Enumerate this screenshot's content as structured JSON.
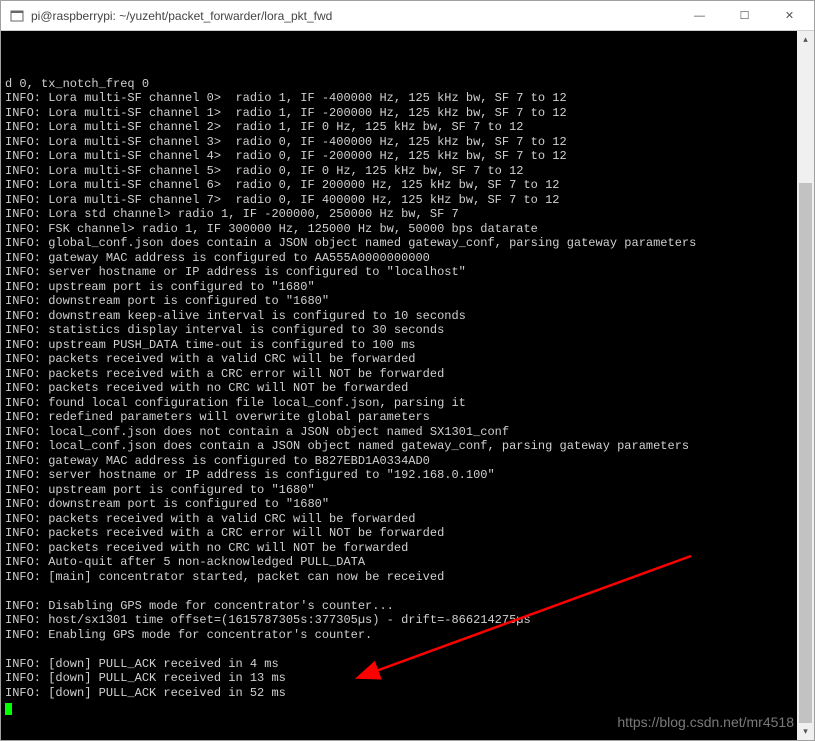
{
  "window": {
    "title": "pi@raspberrypi: ~/yuzeht/packet_forwarder/lora_pkt_fwd",
    "icons": {
      "app": "terminal-icon",
      "minimize": "minimize-icon",
      "maximize": "maximize-icon",
      "close": "close-icon"
    }
  },
  "terminal": {
    "lines": [
      "d 0, tx_notch_freq 0",
      "INFO: Lora multi-SF channel 0>  radio 1, IF -400000 Hz, 125 kHz bw, SF 7 to 12",
      "INFO: Lora multi-SF channel 1>  radio 1, IF -200000 Hz, 125 kHz bw, SF 7 to 12",
      "INFO: Lora multi-SF channel 2>  radio 1, IF 0 Hz, 125 kHz bw, SF 7 to 12",
      "INFO: Lora multi-SF channel 3>  radio 0, IF -400000 Hz, 125 kHz bw, SF 7 to 12",
      "INFO: Lora multi-SF channel 4>  radio 0, IF -200000 Hz, 125 kHz bw, SF 7 to 12",
      "INFO: Lora multi-SF channel 5>  radio 0, IF 0 Hz, 125 kHz bw, SF 7 to 12",
      "INFO: Lora multi-SF channel 6>  radio 0, IF 200000 Hz, 125 kHz bw, SF 7 to 12",
      "INFO: Lora multi-SF channel 7>  radio 0, IF 400000 Hz, 125 kHz bw, SF 7 to 12",
      "INFO: Lora std channel> radio 1, IF -200000, 250000 Hz bw, SF 7",
      "INFO: FSK channel> radio 1, IF 300000 Hz, 125000 Hz bw, 50000 bps datarate",
      "INFO: global_conf.json does contain a JSON object named gateway_conf, parsing gateway parameters",
      "INFO: gateway MAC address is configured to AA555A0000000000",
      "INFO: server hostname or IP address is configured to \"localhost\"",
      "INFO: upstream port is configured to \"1680\"",
      "INFO: downstream port is configured to \"1680\"",
      "INFO: downstream keep-alive interval is configured to 10 seconds",
      "INFO: statistics display interval is configured to 30 seconds",
      "INFO: upstream PUSH_DATA time-out is configured to 100 ms",
      "INFO: packets received with a valid CRC will be forwarded",
      "INFO: packets received with a CRC error will NOT be forwarded",
      "INFO: packets received with no CRC will NOT be forwarded",
      "INFO: found local configuration file local_conf.json, parsing it",
      "INFO: redefined parameters will overwrite global parameters",
      "INFO: local_conf.json does not contain a JSON object named SX1301_conf",
      "INFO: local_conf.json does contain a JSON object named gateway_conf, parsing gateway parameters",
      "INFO: gateway MAC address is configured to B827EBD1A0334AD0",
      "INFO: server hostname or IP address is configured to \"192.168.0.100\"",
      "INFO: upstream port is configured to \"1680\"",
      "INFO: downstream port is configured to \"1680\"",
      "INFO: packets received with a valid CRC will be forwarded",
      "INFO: packets received with a CRC error will NOT be forwarded",
      "INFO: packets received with no CRC will NOT be forwarded",
      "INFO: Auto-quit after 5 non-acknowledged PULL_DATA",
      "INFO: [main] concentrator started, packet can now be received",
      "",
      "INFO: Disabling GPS mode for concentrator's counter...",
      "INFO: host/sx1301 time offset=(1615787305s:377305µs) - drift=-866214275µs",
      "INFO: Enabling GPS mode for concentrator's counter.",
      "",
      "INFO: [down] PULL_ACK received in 4 ms",
      "INFO: [down] PULL_ACK received in 13 ms",
      "INFO: [down] PULL_ACK received in 52 ms"
    ]
  },
  "annotation": {
    "arrow_color": "#ff0000",
    "arrow_target_line": "INFO: [down] PULL_ACK received in 13 ms"
  },
  "watermark": "https://blog.csdn.net/mr4518"
}
